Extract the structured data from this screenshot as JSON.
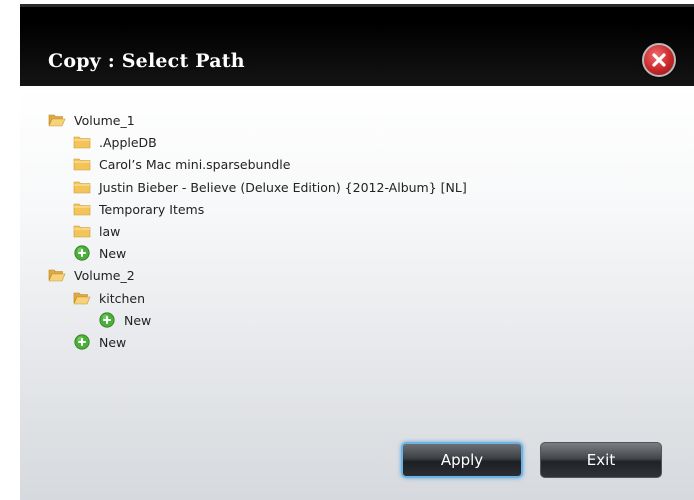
{
  "dialog": {
    "title": "Copy : Select Path"
  },
  "tree": [
    {
      "label": "Volume_1",
      "type": "folder-open"
    },
    {
      "label": ".AppleDB",
      "type": "folder"
    },
    {
      "label": "Carol’s Mac mini.sparsebundle",
      "type": "folder"
    },
    {
      "label": "Justin Bieber - Believe (Deluxe Edition) {2012-Album} [NL]",
      "type": "folder"
    },
    {
      "label": "Temporary Items",
      "type": "folder"
    },
    {
      "label": "law",
      "type": "folder"
    },
    {
      "label": "New",
      "type": "add"
    },
    {
      "label": "Volume_2",
      "type": "folder-open"
    },
    {
      "label": "kitchen",
      "type": "folder-open"
    },
    {
      "label": "New",
      "type": "add"
    },
    {
      "label": "New",
      "type": "add"
    }
  ],
  "buttons": {
    "apply": "Apply",
    "exit": "Exit"
  },
  "colors": {
    "accent": "#6fb3e6",
    "folder": "#f2c45a",
    "add": "#4caf3a",
    "close": "#c8282a"
  }
}
